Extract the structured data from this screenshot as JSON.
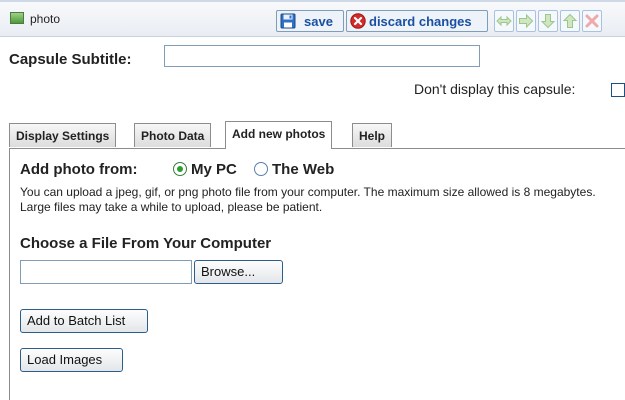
{
  "window": {
    "title": "photo",
    "title_icon": "image-icon"
  },
  "toolbar": {
    "save_label": "save",
    "discard_label": "discard changes",
    "save_icon": "floppy-disk-icon",
    "discard_icon": "red-x-circle-icon",
    "nav_icons": [
      "resize-horizontal-icon",
      "arrow-right-icon",
      "arrow-down-icon",
      "arrow-up-icon",
      "close-icon"
    ]
  },
  "capsule": {
    "subtitle_label": "Capsule Subtitle:",
    "subtitle_value": "",
    "dont_display_label": "Don't display this capsule:",
    "dont_display_checked": false
  },
  "tabs": [
    {
      "label": "Display Settings",
      "active": false
    },
    {
      "label": "Photo Data",
      "active": false
    },
    {
      "label": "Add new photos",
      "active": true
    },
    {
      "label": "Help",
      "active": false
    }
  ],
  "add_photos": {
    "add_from_label": "Add photo from:",
    "options": [
      {
        "label": "My PC",
        "checked": true
      },
      {
        "label": "The Web",
        "checked": false
      }
    ],
    "help_text": "You can upload a jpeg, gif, or png photo file from your computer. The maximum size allowed is 8 megabytes. Large files may take a while to upload, please be patient.",
    "choose_heading": "Choose a File From Your Computer",
    "file_value": "",
    "browse_label": "Browse...",
    "add_batch_label": "Add to Batch List",
    "load_images_label": "Load Images"
  },
  "colors": {
    "link_blue": "#1b4fa0",
    "radio_green": "#2e9e2e",
    "discard_red": "#d42a2a"
  }
}
